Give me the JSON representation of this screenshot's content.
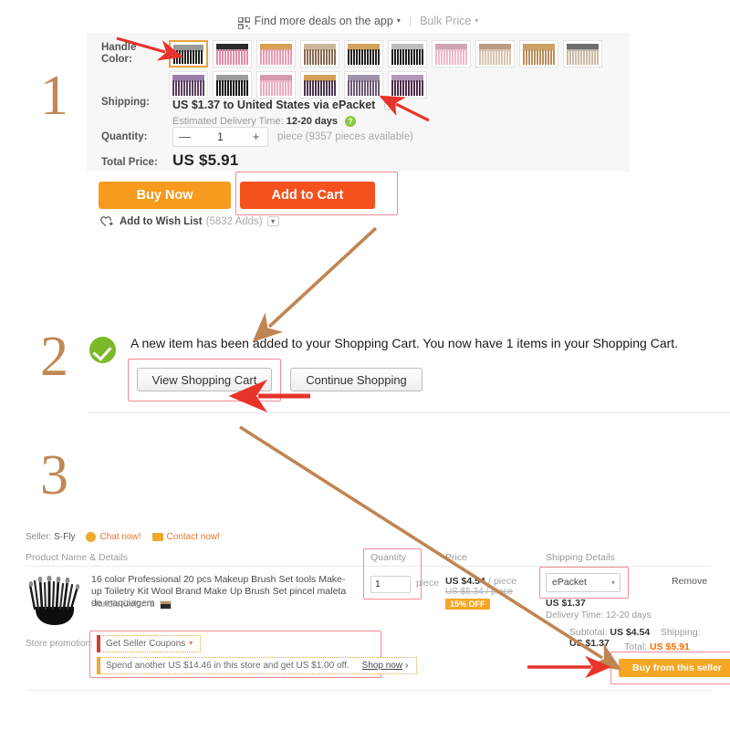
{
  "steps": {
    "one": "1",
    "two": "2",
    "three": "3"
  },
  "colors": {
    "accent_orange": "#f79a1e",
    "cart_red": "#f4511e",
    "highlight_pink": "#f08a96",
    "arrow_tan": "#c08552",
    "arrow_red": "#e8332a",
    "numeral_tan": "#c08856",
    "total_orange": "#ff6a00",
    "success_green": "#7cb828"
  },
  "app_bar": {
    "qr_icon": "qr-code-icon",
    "find_deals": "Find more deals on the app",
    "separator": "|",
    "bulk_price": "Bulk Price",
    "caret": "▾"
  },
  "product": {
    "handle_color_label": "Handle\nColor:",
    "handle_color_label_line1": "Handle",
    "handle_color_label_line2": "Color:",
    "swatches_row1": [
      {
        "name": "black-silver",
        "top": "#9a9a9a",
        "body": "#1e1e1e",
        "selected": true
      },
      {
        "name": "pink-black",
        "top": "#2b2b2b",
        "body": "#e48aa6",
        "selected": false
      },
      {
        "name": "pink-gold",
        "top": "#d9a054",
        "body": "#e79ab4",
        "selected": false
      },
      {
        "name": "brown-tan",
        "top": "#cbb79b",
        "body": "#8a6a52",
        "selected": false
      },
      {
        "name": "black-gold",
        "top": "#d4a35a",
        "body": "#242424",
        "selected": false
      },
      {
        "name": "black-silver-2",
        "top": "#bdbdbd",
        "body": "#1f1f1f",
        "selected": false
      },
      {
        "name": "light-pink",
        "top": "#cfa7b4",
        "body": "#f0b9cb",
        "selected": false
      },
      {
        "name": "nude-beige",
        "top": "#b99d86",
        "body": "#d9c3ae",
        "selected": false
      },
      {
        "name": "tan-gold",
        "top": "#caa063",
        "body": "#b98f5e",
        "selected": false
      },
      {
        "name": "beige-black",
        "top": "#6e6e6e",
        "body": "#cbb9a5",
        "selected": false
      }
    ],
    "swatches_row2": [
      {
        "name": "purple-dark",
        "top": "#9b7fa8",
        "body": "#5a3f5e",
        "selected": false
      },
      {
        "name": "black-grey",
        "top": "#9c9c9c",
        "body": "#171717",
        "selected": false
      },
      {
        "name": "pink-light",
        "top": "#d59ab0",
        "body": "#eda9c0",
        "selected": false
      },
      {
        "name": "purple-gold",
        "top": "#d3a055",
        "body": "#4b3550",
        "selected": false
      },
      {
        "name": "violet-grey",
        "top": "#9f93ab",
        "body": "#6b5a73",
        "selected": false
      },
      {
        "name": "plum",
        "top": "#b397b8",
        "body": "#4e2b4a",
        "selected": false
      }
    ],
    "shipping_label": "Shipping:",
    "shipping_value": "US $1.37 to United States via ePacket",
    "shipping_dropdown_icon": "chevron-down-icon",
    "delivery_label": "Estimated Delivery Time:",
    "delivery_value": "12-20 days",
    "help_icon": "?",
    "quantity_label": "Quantity:",
    "quantity_minus": "—",
    "quantity_value": "1",
    "quantity_plus": "+",
    "quantity_note": "piece (9357 pieces available)",
    "total_price_label": "Total Price:",
    "total_price_value": "US $5.91",
    "buy_now": "Buy Now",
    "add_to_cart": "Add to Cart",
    "wish_icon": "heart-plus-icon",
    "wish_label": "Add to Wish List",
    "wish_count": "(5832 Adds)"
  },
  "confirmation": {
    "check_icon": "check-circle-icon",
    "message": "A new item has been added to your Shopping Cart. You now have 1 items in your Shopping Cart.",
    "view_cart": "View Shopping Cart",
    "continue_shopping": "Continue Shopping"
  },
  "cart": {
    "seller_label": "Seller:",
    "seller_name": "S-Fly",
    "chat_icon": "chat-icon",
    "chat_label": "Chat now!",
    "contact_icon": "mail-icon",
    "contact_label": "Contact now!",
    "columns": {
      "product": "Product Name & Details",
      "quantity": "Quantity",
      "price": "Price",
      "shipping": "Shipping Details"
    },
    "item": {
      "thumb_icon": "makeup-brush-set-thumbnail",
      "name": "16 color Professional 20 pcs Makeup Brush Set tools Make-up Toiletry Kit Wool Brand Make Up Brush Set pincel maleta de maquiagem",
      "attr_label": "Handle Color:",
      "attr_value": "1",
      "attr_swatch_icon": "color-swatch-icon",
      "qty_value": "1",
      "qty_unit": "piece",
      "price_current": "US $4.54",
      "price_unit": "/ piece",
      "price_original": "US $5.34 / piece",
      "discount_badge": "15% OFF",
      "ship_method": "ePacket",
      "ship_cost": "US $1.37",
      "ship_time": "Delivery Time: 12-20 days",
      "remove": "Remove"
    },
    "promotion": {
      "label": "Store promotion:",
      "coupons": "Get Seller Coupons",
      "coupons_caret": "▾",
      "spend_more": "Spend another US $14.46 in this store and get US $1.00 off.",
      "shop_now": "Shop now",
      "shop_now_caret": "›"
    },
    "totals": {
      "subtotal_label": "Subtotal:",
      "subtotal_value": "US $4.54",
      "shipping_label": "Shipping:",
      "shipping_value": "US $1.37",
      "total_label": "Total:",
      "total_value": "US $5.91",
      "buy_button": "Buy from this seller"
    }
  }
}
